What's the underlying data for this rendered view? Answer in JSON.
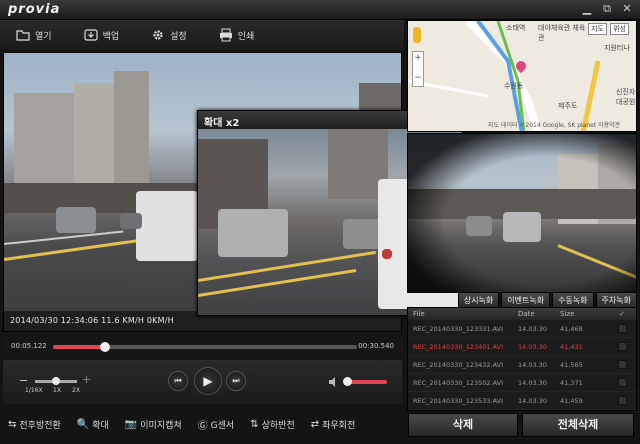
{
  "app": {
    "logo": "provia"
  },
  "window": {
    "minimize": "▁",
    "restore": "⧉",
    "close": "✕"
  },
  "toolbar": [
    {
      "label": "열기",
      "icon": "folder-icon"
    },
    {
      "label": "백업",
      "icon": "backup-icon"
    },
    {
      "label": "설정",
      "icon": "gear-icon"
    },
    {
      "label": "인쇄",
      "icon": "print-icon"
    }
  ],
  "video": {
    "timestamp": "2014/03/30 12:34:06 11.6 KM/H  0KM/H"
  },
  "zoom": {
    "title": "확대 x2",
    "minimize": "_",
    "close": "✕"
  },
  "map": {
    "labels": [
      "소태역",
      "대야체육관 체육관",
      "지원터나",
      "신진자 대공원",
      "수원동",
      "제주도"
    ],
    "mode_map": "지도",
    "mode_sat": "위성",
    "copyright": "지도 데이터 ©2014 Google, SK planet  이용약관",
    "zoom_in": "+",
    "zoom_out": "−"
  },
  "tabs": [
    "상시녹화",
    "이벤트녹화",
    "수동녹화",
    "주차녹화"
  ],
  "filelist": {
    "headers": {
      "name": "File",
      "date": "Date",
      "size": "Size",
      "check": "✓"
    },
    "rows": [
      {
        "name": "REC_20140330_123331.AVI",
        "date": "14.03.30",
        "size": "41,468",
        "selected": false
      },
      {
        "name": "REC_20140330_123401.AVI",
        "date": "14.03.30",
        "size": "41,431",
        "selected": true
      },
      {
        "name": "REC_20140330_123432.AVI",
        "date": "14.03.30",
        "size": "41,565",
        "selected": false
      },
      {
        "name": "REC_20140330_123502.AVI",
        "date": "14.03.30",
        "size": "41,371",
        "selected": false
      },
      {
        "name": "REC_20140330_123533.AVI",
        "date": "14.03.30",
        "size": "41,459",
        "selected": false
      }
    ]
  },
  "actions": {
    "delete": "삭제",
    "delete_all": "전체삭제"
  },
  "timeline": {
    "current": "00:05.122",
    "total": "00:30.540",
    "progress": 0.17
  },
  "speed": {
    "labels": [
      "1/16X",
      "1X",
      "2X"
    ],
    "minus": "−",
    "plus": "+",
    "value": 0.5
  },
  "playback": {
    "prev": "⏮",
    "play": "▶",
    "next": "⏭"
  },
  "volume": {
    "level": 0.05,
    "icon": "speaker-icon"
  },
  "bottom": [
    {
      "label": "전후방전환",
      "icon": "swap-icon",
      "glyph": "⇆"
    },
    {
      "label": "확대",
      "icon": "magnify-icon",
      "glyph": "🔍"
    },
    {
      "label": "이미지캡쳐",
      "icon": "camera-icon",
      "glyph": "📷"
    },
    {
      "label": "G센서",
      "icon": "gsensor-icon",
      "glyph": "Ⓖ"
    },
    {
      "label": "상하반전",
      "icon": "flip-vertical-icon",
      "glyph": "⇅"
    },
    {
      "label": "좌우회전",
      "icon": "flip-horizontal-icon",
      "glyph": "⇄"
    }
  ],
  "colors": {
    "accent": "#e04454",
    "selected_row": "#e04040"
  }
}
